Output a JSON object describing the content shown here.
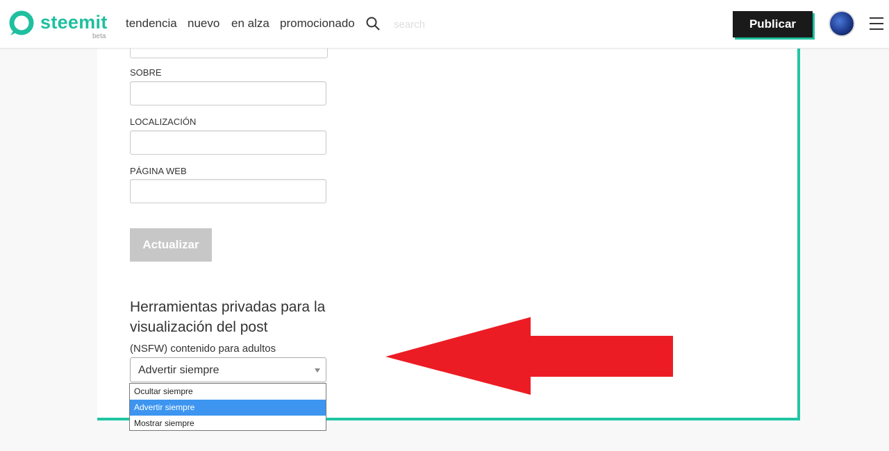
{
  "header": {
    "logo_text": "steemit",
    "logo_beta": "beta",
    "nav": [
      "tendencia",
      "nuevo",
      "en alza",
      "promocionado"
    ],
    "search_placeholder": "search",
    "publish_label": "Publicar"
  },
  "form": {
    "labels": {
      "about": "SOBRE",
      "location": "LOCALIZACIÓN",
      "website": "PÁGINA WEB"
    },
    "update_button": "Actualizar"
  },
  "privacy": {
    "title": "Herramientas privadas para la visualización del post",
    "nsfw_label": "(NSFW) contenido para adultos",
    "selected_value": "Advertir siempre",
    "options": [
      "Ocultar siempre",
      "Advertir siempre",
      "Mostrar siempre"
    ],
    "selected_index": 1
  },
  "colors": {
    "brand": "#1fbf9f",
    "card_border": "#1fc6a3",
    "arrow": "#ec1c24",
    "option_highlight": "#3d95f0",
    "publish_bg": "#1a1a1a"
  },
  "icons": {
    "logo": "steemit-logo-icon",
    "search": "search-icon",
    "menu": "hamburger-menu-icon",
    "select_caret": "chevron-down-icon",
    "annotation": "red-arrow-icon"
  }
}
